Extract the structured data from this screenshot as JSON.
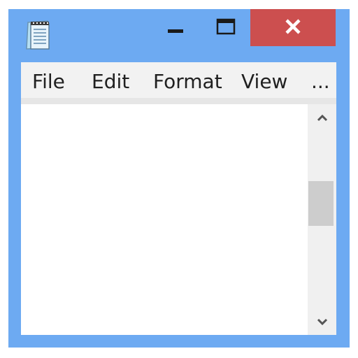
{
  "window": {
    "accent_color": "#6daaf2",
    "close_color": "#cc4f4f",
    "app_icon": "notepad-icon"
  },
  "titlebar": {
    "minimize_icon": "minimize-icon",
    "maximize_icon": "maximize-icon",
    "close_icon": "close-icon"
  },
  "menu": {
    "items": [
      {
        "label": "File"
      },
      {
        "label": "Edit"
      },
      {
        "label": "Format"
      },
      {
        "label": "View"
      },
      {
        "label": "..."
      }
    ]
  },
  "editor": {
    "content": ""
  },
  "scrollbar": {
    "up_icon": "chevron-up-icon",
    "down_icon": "chevron-down-icon"
  }
}
